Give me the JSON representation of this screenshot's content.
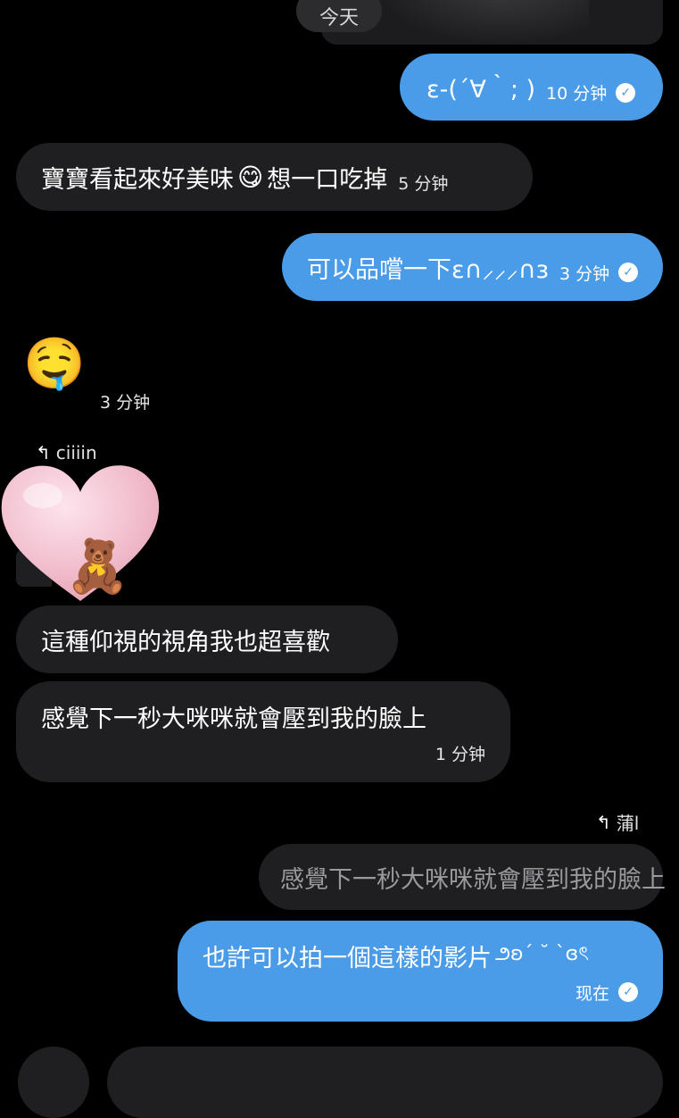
{
  "date_divider": "今天",
  "messages": [
    {
      "id": "m1",
      "direction": "out",
      "text": "ε-(´∀｀; )",
      "time": "10 分钟",
      "read": true
    },
    {
      "id": "m2",
      "direction": "in",
      "text": "寶寶看起來好美味",
      "emoji": "😋",
      "text2": "想一口吃掉",
      "time": "5 分钟"
    },
    {
      "id": "m3",
      "direction": "out",
      "text": "可以品嚐一下ε∩⸝⸝⸝∩з",
      "time": "3 分钟",
      "read": true
    },
    {
      "id": "m4",
      "direction": "in",
      "emoji": "🤤",
      "time": "3 分钟"
    },
    {
      "id": "m5",
      "reply_to": "ciiiin",
      "reaction_emoji": "🩷",
      "sticker_emoji": "🧸"
    },
    {
      "id": "m6",
      "direction": "in",
      "text": "這種仰視的視角我也超喜歡"
    },
    {
      "id": "m7",
      "direction": "in",
      "text": "感覺下一秒大咪咪就會壓到我的臉上",
      "time": "1 分钟"
    },
    {
      "id": "m8",
      "direction": "out",
      "reply_to": "蒲l",
      "quoted_text": "感覺下一秒大咪咪就會壓到我的臉上",
      "text": "也許可以拍一個這樣的影片",
      "kaomoji": "౨ʚ´ ˘ `ɞৎ",
      "time": "现在",
      "read": true
    }
  ],
  "icons": {
    "read_check": "check-icon",
    "reply": "reply-arrow-icon"
  },
  "colors": {
    "outgoing": "#4a9be8",
    "incoming": "#1f1f21",
    "background": "#000000"
  }
}
